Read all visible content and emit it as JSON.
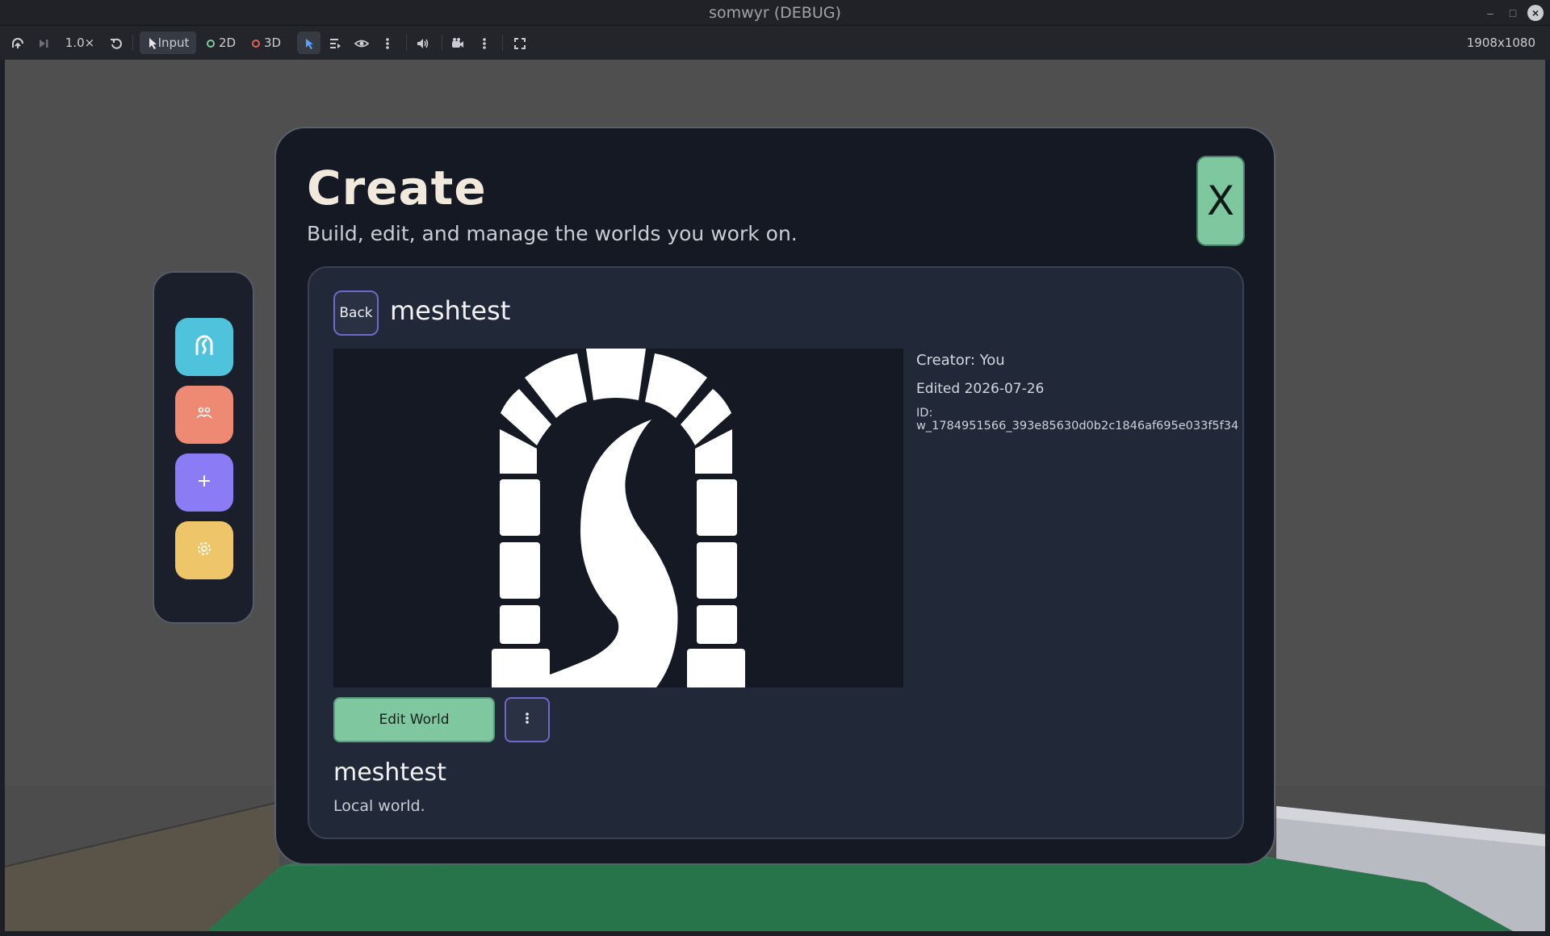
{
  "window": {
    "title": "somwyr (DEBUG)",
    "minimize_glyph": "–",
    "maximize_glyph": "□",
    "close_glyph": "×"
  },
  "toolbar": {
    "speed": "1.0×",
    "input_label": "Input",
    "mode_2d_label": "2D",
    "mode_3d_label": "3D",
    "resolution": "1908x1080",
    "colors": {
      "dot_2d": "#7fc89f",
      "dot_3d": "#e0605a",
      "select_active": "#5aa0ff"
    },
    "icons": [
      "remote-debug-icon",
      "step-frame-icon",
      "reset-speed-icon",
      "input-pointer-icon",
      "select-arrow-icon",
      "list-tree-icon",
      "eye-icon",
      "menu-dots-icon",
      "speaker-icon",
      "camera-icon",
      "menu-dots-icon",
      "fullscreen-icon"
    ]
  },
  "dock": {
    "items": [
      {
        "name": "dock-home-button",
        "color": "#4fc3dc",
        "icon": "portal-logo-icon"
      },
      {
        "name": "dock-people-button",
        "color": "#ee8a73",
        "icon": "people-icon"
      },
      {
        "name": "dock-create-button",
        "color": "#8b7cf5",
        "icon": "plus-icon",
        "glyph": "+"
      },
      {
        "name": "dock-settings-button",
        "color": "#efc56a",
        "icon": "gear-icon"
      }
    ]
  },
  "panel": {
    "title": "Create",
    "subtitle": "Build, edit, and manage the worlds you work on.",
    "close_label": "X",
    "accent": "#7fc89f"
  },
  "world": {
    "back_label": "Back",
    "name": "meshtest",
    "creator": "Creator: You",
    "edited": "Edited 2026-07-26",
    "id": "ID: w_1784951566_393e85630d0b2c1846af695e033f5f34",
    "edit_label": "Edit World",
    "description": "Local world."
  }
}
